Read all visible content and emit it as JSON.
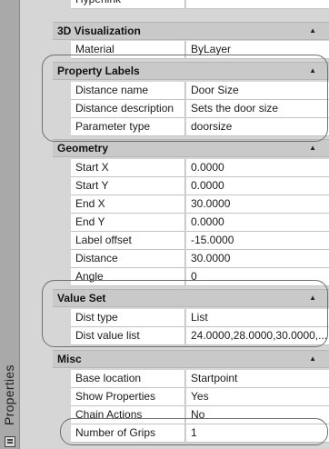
{
  "panel": {
    "title": "Properties"
  },
  "partial_row": {
    "name": "Hyperlink",
    "value": ""
  },
  "categories": [
    {
      "label": "3D Visualization",
      "rows": [
        {
          "name": "Material",
          "value": "ByLayer"
        }
      ]
    },
    {
      "label": "Property Labels",
      "rows": [
        {
          "name": "Distance name",
          "value": "Door Size"
        },
        {
          "name": "Distance description",
          "value": "Sets the door size"
        },
        {
          "name": "Parameter type",
          "value": "doorsize"
        }
      ]
    },
    {
      "label": "Geometry",
      "rows": [
        {
          "name": "Start X",
          "value": "0.0000"
        },
        {
          "name": "Start Y",
          "value": "0.0000"
        },
        {
          "name": "End X",
          "value": "30.0000"
        },
        {
          "name": "End Y",
          "value": "0.0000"
        },
        {
          "name": "Label offset",
          "value": "-15.0000"
        },
        {
          "name": "Distance",
          "value": "30.0000"
        },
        {
          "name": "Angle",
          "value": "0"
        }
      ]
    },
    {
      "label": "Value Set",
      "rows": [
        {
          "name": "Dist type",
          "value": "List"
        },
        {
          "name": "Dist value list",
          "value": "24.0000,28.0000,30.0000,..."
        }
      ]
    },
    {
      "label": "Misc",
      "rows": [
        {
          "name": "Base location",
          "value": "Startpoint"
        },
        {
          "name": "Show Properties",
          "value": "Yes"
        },
        {
          "name": "Chain Actions",
          "value": "No"
        },
        {
          "name": "Number of Grips",
          "value": "1"
        }
      ]
    }
  ],
  "icons": {
    "collapse": "triangle-up-icon",
    "panel": "panel-icon"
  }
}
